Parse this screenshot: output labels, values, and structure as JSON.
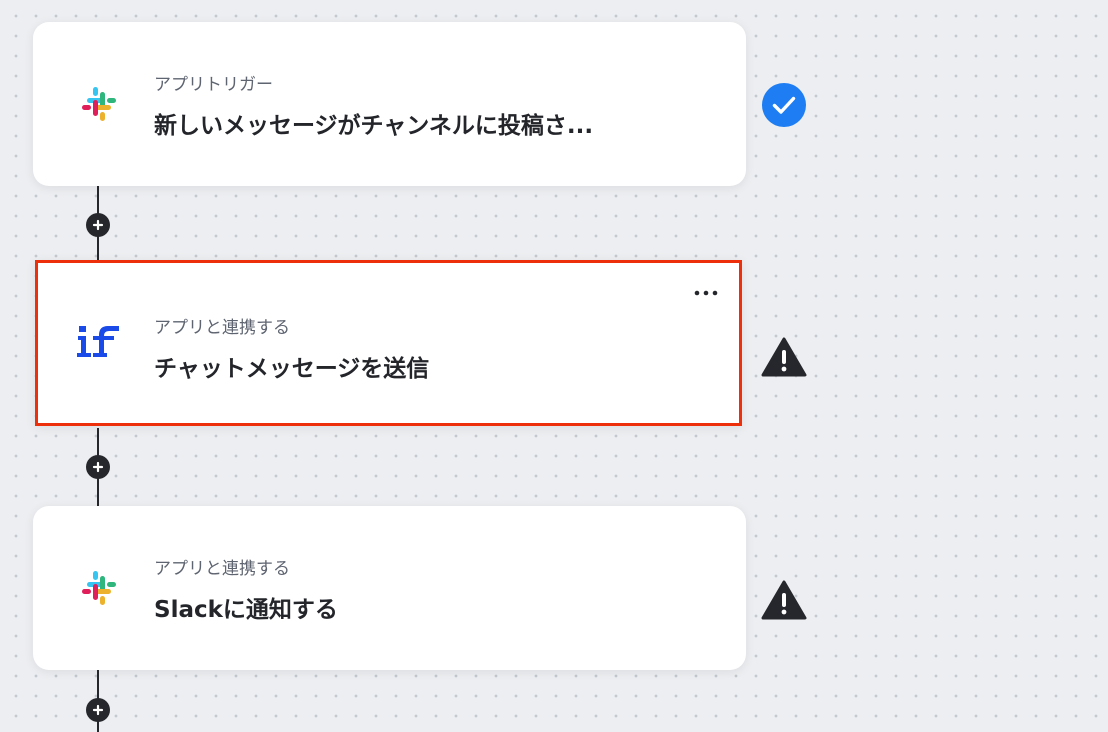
{
  "flow": {
    "steps": [
      {
        "subtitle": "アプリトリガー",
        "title": "新しいメッセージがチャンネルに投稿さ...",
        "app_icon": "slack-icon",
        "status": "check-circle-icon"
      },
      {
        "subtitle": "アプリと連携する",
        "title": "チャットメッセージを送信",
        "app_icon": "if-logo-icon",
        "status": "warning-triangle-icon",
        "selected": true
      },
      {
        "subtitle": "アプリと連携する",
        "title": "Slackに通知する",
        "app_icon": "slack-icon",
        "status": "warning-triangle-icon"
      }
    ]
  },
  "colors": {
    "background": "#eceef1",
    "connector": "#25272c",
    "highlight_border": "#ee2f0b",
    "check_blue": "#1e7df2",
    "warning_dark": "#25272c",
    "if_logo_blue": "#1a4ae8",
    "slack_blue": "#36c5f0",
    "slack_green": "#2eb67d",
    "slack_yellow": "#ecb22e",
    "slack_red": "#e01e5a"
  }
}
